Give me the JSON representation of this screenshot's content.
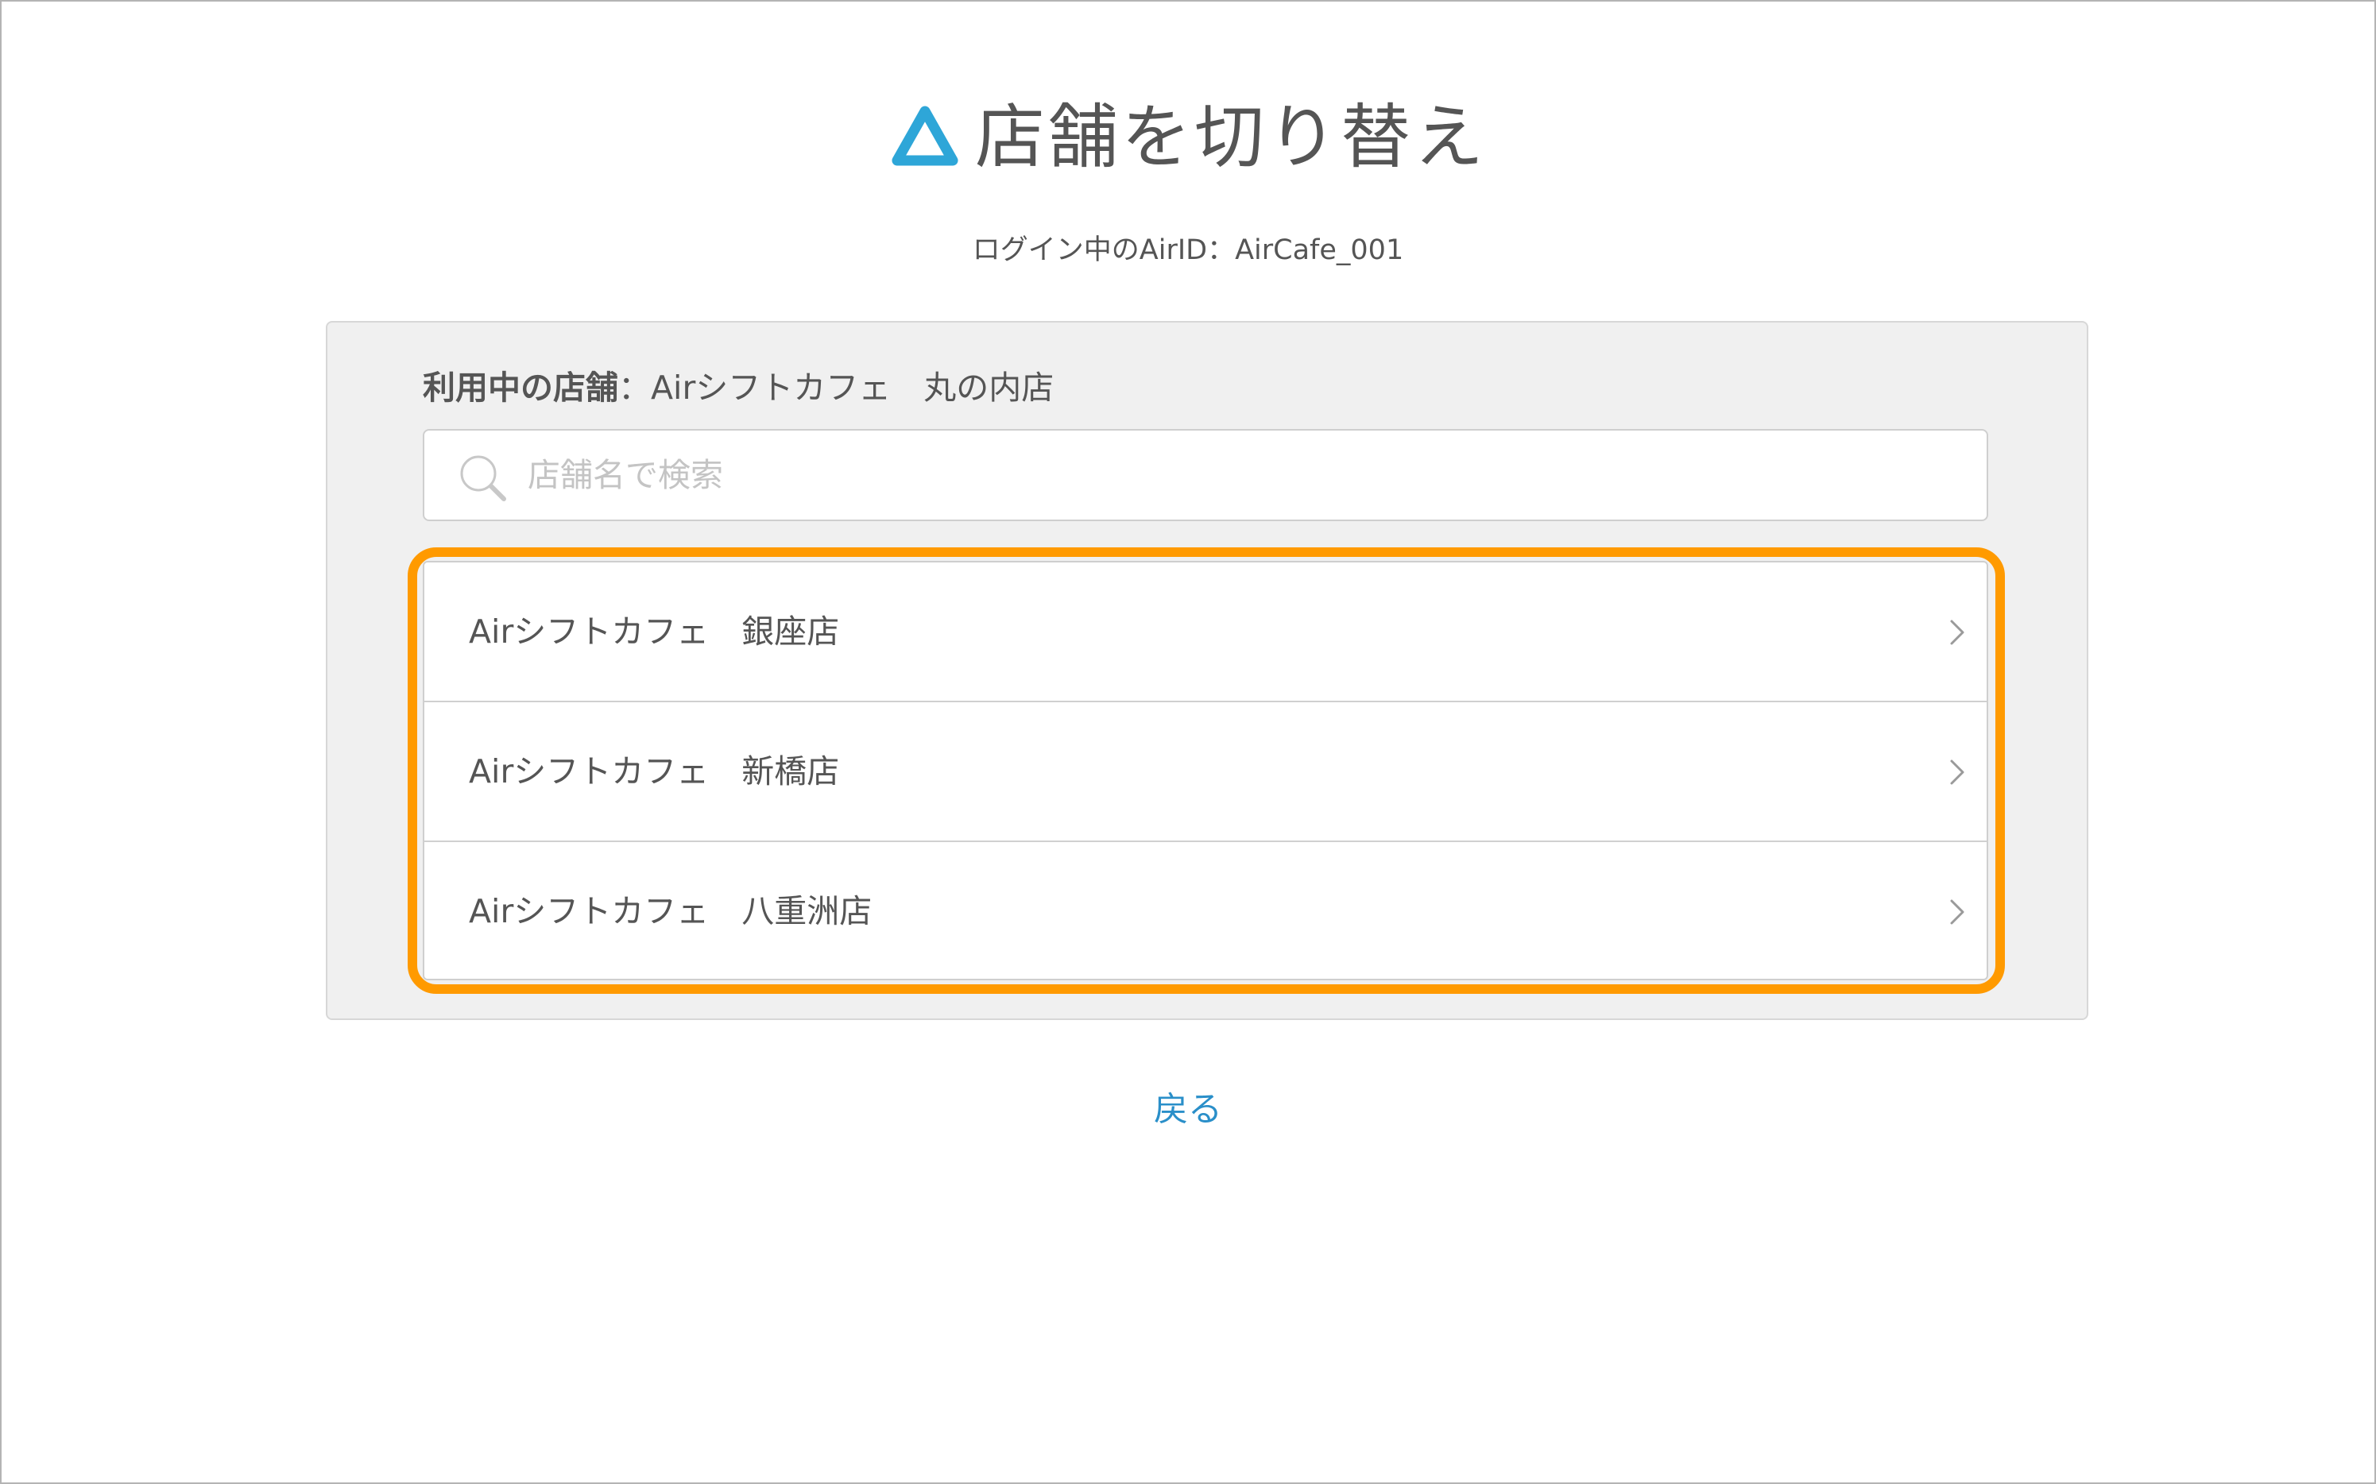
{
  "header": {
    "title": "店舗を切り替え",
    "logo_icon": "air-triangle-logo-icon",
    "logo_color": "#2ea6d8"
  },
  "login_info": {
    "text": "ログイン中のAirID：AirCafe_001"
  },
  "current_store": {
    "label": "利用中の店舗",
    "separator": "：",
    "value": "Airシフトカフェ　丸の内店"
  },
  "search": {
    "placeholder": "店舗名で検索",
    "value": "",
    "icon": "search-icon"
  },
  "stores": [
    {
      "name": "Airシフトカフェ　銀座店"
    },
    {
      "name": "Airシフトカフェ　新橋店"
    },
    {
      "name": "Airシフトカフェ　八重洲店"
    }
  ],
  "highlight_color": "#ff9a00",
  "back": {
    "label": "戻る",
    "color": "#2a8fc9"
  }
}
